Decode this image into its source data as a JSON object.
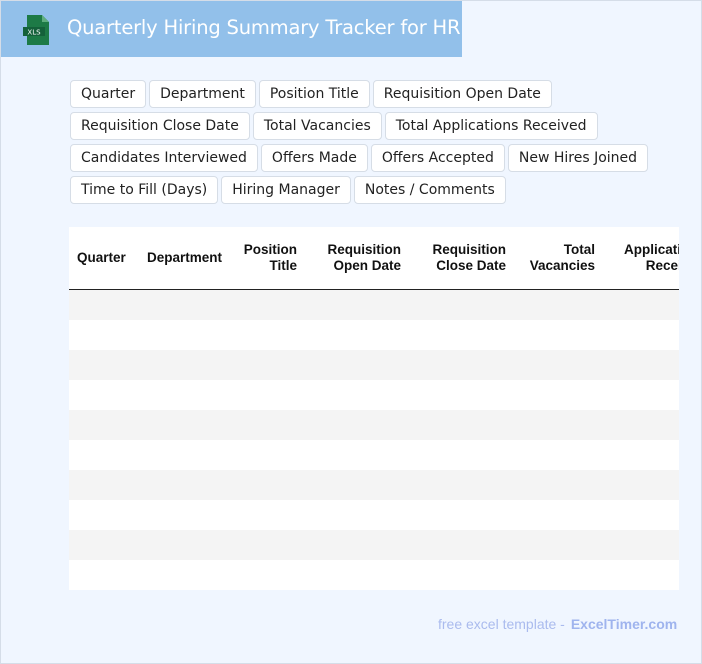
{
  "header": {
    "title": "Quarterly Hiring Summary Tracker for HR",
    "icon_label": "XLS",
    "icon_color": "#1d7a46",
    "bg_color": "#92c0ea"
  },
  "fields": [
    "Quarter",
    "Department",
    "Position Title",
    "Requisition Open Date",
    "Requisition Close Date",
    "Total Vacancies",
    "Total Applications Received",
    "Candidates Interviewed",
    "Offers Made",
    "Offers Accepted",
    "New Hires Joined",
    "Time to Fill (Days)",
    "Hiring Manager",
    "Notes / Comments"
  ],
  "table": {
    "columns": [
      [
        "Quarter"
      ],
      [
        "Department"
      ],
      [
        "Position",
        "Title"
      ],
      [
        "Requisition",
        "Open Date"
      ],
      [
        "Requisition",
        "Close Date"
      ],
      [
        "Total",
        "Vacancies"
      ],
      [
        "Applications",
        "Received"
      ]
    ],
    "row_count": 10
  },
  "footer": {
    "text": "free excel template -",
    "brand": "ExcelTimer.com"
  }
}
